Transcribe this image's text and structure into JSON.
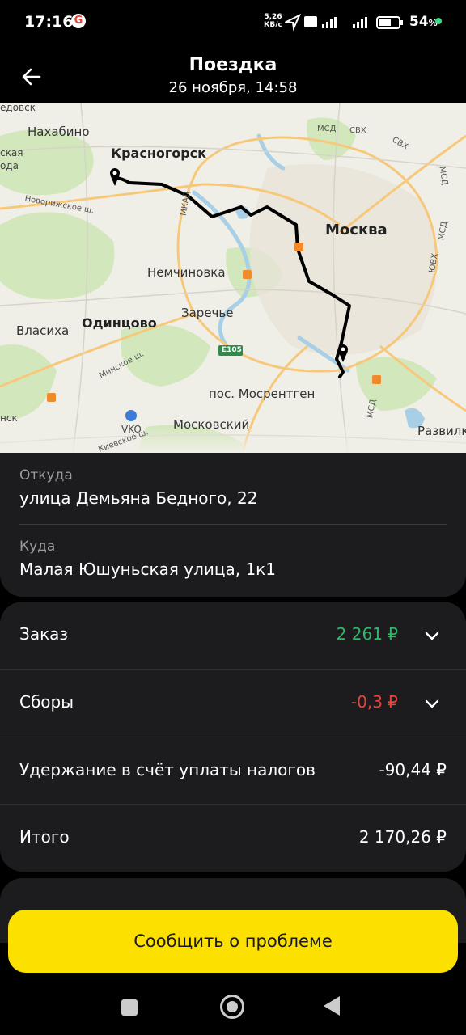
{
  "status_bar": {
    "time": "17:16",
    "google_icon": "G",
    "net_speed_top": "5,26",
    "net_speed_bottom": "КБ/с",
    "battery_percent": "54",
    "battery_unit": "%"
  },
  "header": {
    "title": "Поездка",
    "subtitle": "26 ноября, 14:58",
    "back_icon": "arrow-left-icon"
  },
  "map": {
    "labels": {
      "nakhabino": "Нахабино",
      "krasnogorsk": "Красногорск",
      "moskva": "Москва",
      "nemchinovka": "Немчиновка",
      "zarechye": "Заречье",
      "odintsovo": "Одинцово",
      "vlasikha": "Власиха",
      "mosrentgen": "пос. Мосрентген",
      "moskovsky": "Московский",
      "vko": "VKO",
      "razvilka": "Развилк",
      "dedovsk": "едовск",
      "left_edge_1": "ская",
      "left_edge_2": "ода",
      "left_edge_3": "нск",
      "mkad": "МКАД",
      "msd_1": "МСД",
      "svkh_1": "СВХ",
      "svkh_2": "СВХ",
      "msd_2": "МСД",
      "msd_3": "МСД",
      "yuvkh": "ЮВХ",
      "msd_4": "МСД",
      "e105": "Е105",
      "novorizhskoe": "Новорижское ш.",
      "minskoe": "Минское ш.",
      "kievskoe": "Киевское ш."
    }
  },
  "route": {
    "from_label": "Откуда",
    "from_value": "улица Демьяна Бедного, 22",
    "to_label": "Куда",
    "to_value": "Малая Юшуньская улица, 1к1"
  },
  "finance": {
    "order_label": "Заказ",
    "order_value": "2 261 ₽",
    "order_color": "#2fb86a",
    "fees_label": "Сборы",
    "fees_value": "-0,3 ₽",
    "fees_color": "#e8443a",
    "tax_label": "Удержание в счёт уплаты налогов",
    "tax_value": "-90,44 ₽",
    "total_label": "Итого",
    "total_value": "2 170,26 ₽"
  },
  "actions": {
    "report_button": "Сообщить о проблеме"
  },
  "colors": {
    "accent_yellow": "#fce000",
    "card_bg": "#1c1c1e"
  }
}
